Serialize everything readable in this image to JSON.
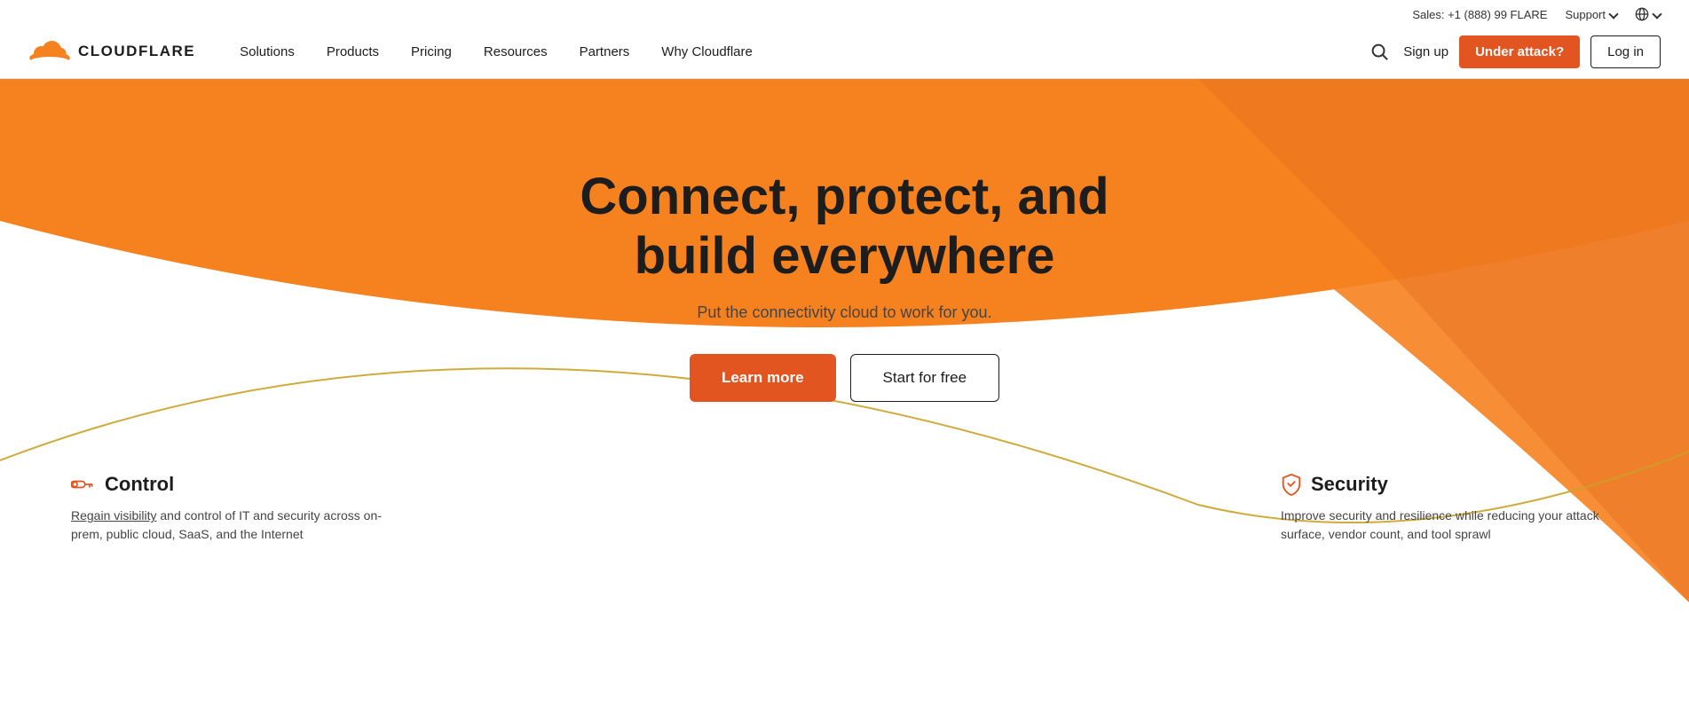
{
  "header": {
    "logo_text": "CLOUDFLARE",
    "sales_text": "Sales: +1 (888) 99 FLARE",
    "support_label": "Support",
    "nav": [
      {
        "label": "Solutions",
        "id": "solutions"
      },
      {
        "label": "Products",
        "id": "products"
      },
      {
        "label": "Pricing",
        "id": "pricing"
      },
      {
        "label": "Resources",
        "id": "resources"
      },
      {
        "label": "Partners",
        "id": "partners"
      },
      {
        "label": "Why Cloudflare",
        "id": "why-cloudflare"
      }
    ],
    "signup_label": "Sign up",
    "under_attack_label": "Under attack?",
    "login_label": "Log in"
  },
  "hero": {
    "title_line1": "Connect, protect, and",
    "title_line2": "build everywhere",
    "subtitle": "Put the connectivity cloud to work for you.",
    "btn_learn_more": "Learn more",
    "btn_start_free": "Start for free"
  },
  "cards": [
    {
      "id": "control",
      "icon": "key-icon",
      "title": "Control",
      "text_underlined": "Regain visibility",
      "text_rest": " and control of IT and security across on-prem, public cloud, SaaS, and the Internet"
    },
    {
      "id": "security",
      "icon": "shield-icon",
      "title": "Security",
      "text": "Improve security and resilience while reducing your attack surface, vendor count, and tool sprawl"
    }
  ],
  "colors": {
    "orange": "#e25420",
    "orange_bg": "#f6821f",
    "dark": "#1d1d1d",
    "yellow_arc": "#d4a827"
  }
}
